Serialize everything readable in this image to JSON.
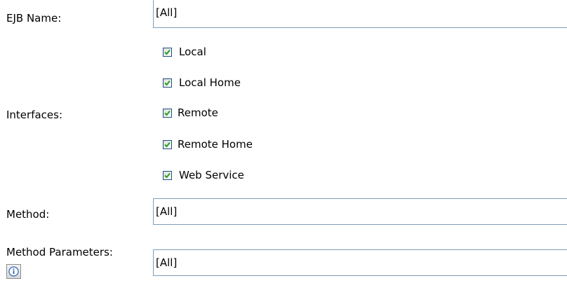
{
  "form": {
    "ejb_name": {
      "label": "EJB Name:",
      "value": "[All]"
    },
    "interfaces": {
      "label": "Interfaces:",
      "options": [
        {
          "label": "Local",
          "checked": true
        },
        {
          "label": "Local Home",
          "checked": true
        },
        {
          "label": "Remote",
          "checked": true
        },
        {
          "label": "Remote Home",
          "checked": true
        },
        {
          "label": "Web Service",
          "checked": true
        }
      ]
    },
    "method": {
      "label": "Method:",
      "value": "[All]"
    },
    "method_parameters": {
      "label": "Method Parameters:",
      "value": "[All]",
      "info_icon": "info-icon"
    }
  },
  "colors": {
    "checkmark": "#21a121",
    "field_border": "#7f9db9",
    "info_icon": "#2a63b8"
  }
}
